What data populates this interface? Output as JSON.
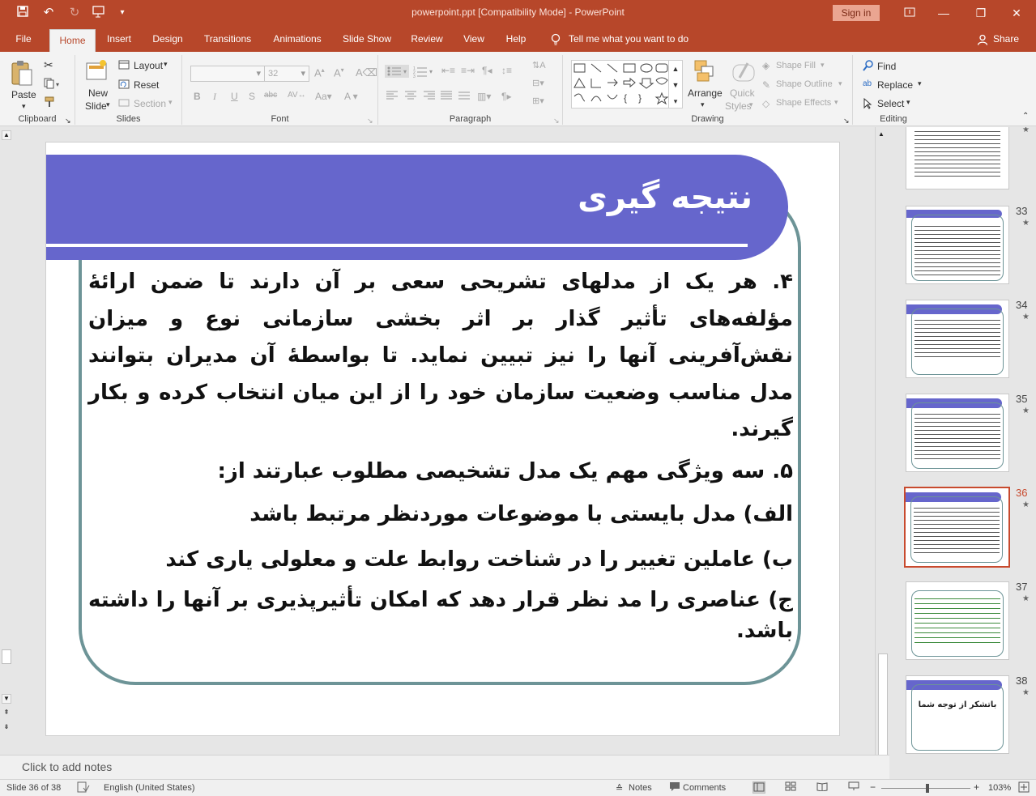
{
  "app": {
    "title": "powerpoint.ppt [Compatibility Mode]  -  PowerPoint",
    "sign_in": "Sign in",
    "share": "Share",
    "tell_me": "Tell me what you want to do"
  },
  "tabs": [
    "File",
    "Home",
    "Insert",
    "Design",
    "Transitions",
    "Animations",
    "Slide Show",
    "Review",
    "View",
    "Help"
  ],
  "ribbon": {
    "clipboard": {
      "label": "Clipboard",
      "paste": "Paste"
    },
    "slides": {
      "label": "Slides",
      "new_slide_1": "New",
      "new_slide_2": "Slide",
      "layout": "Layout",
      "reset": "Reset",
      "section": "Section"
    },
    "font": {
      "label": "Font",
      "size": "32"
    },
    "paragraph": {
      "label": "Paragraph"
    },
    "drawing": {
      "label": "Drawing",
      "arrange": "Arrange",
      "quick_styles_1": "Quick",
      "quick_styles_2": "Styles",
      "shape_fill": "Shape Fill",
      "shape_outline": "Shape Outline",
      "shape_effects": "Shape Effects"
    },
    "editing": {
      "label": "Editing",
      "find": "Find",
      "replace": "Replace",
      "select": "Select"
    }
  },
  "slide": {
    "title": "نتیجه گیری",
    "p4_num": "۴.",
    "p4": "هر یک از مدلهای تشریحی سعی بر آن دارند تا ضمن ارائۀ مؤلفه‌های تأثیر گذار بر اثر بخشی  سازمانی نوع و میزان نقش‌آفرینی آنها را نیز تبیین نماید. تا بواسطۀ آن مدیران بتوانند مدل مناسب  وضعیت سازمان خود را از این میان انتخاب کرده و بکار گیرند.",
    "p5": "۵. سه ویژگی مهم یک مدل تشخیصی مطلوب عبارتند از:",
    "a": "الف) مدل بایستی با موضوعات موردنظر مرتبط باشد",
    "b": "ب) عاملین تغییر را در شناخت روابط علت و معلولی یاری کند",
    "c": "ج) عناصری را مد نظر قرار دهد که امکان تأثیرپذیری بر آنها را داشته باشد."
  },
  "thumbnails": [
    {
      "num": "33"
    },
    {
      "num": "34"
    },
    {
      "num": "35"
    },
    {
      "num": "36"
    },
    {
      "num": "37"
    },
    {
      "num": "38",
      "text": "باتشکر از توجه شما"
    }
  ],
  "notes_placeholder": "Click to add notes",
  "status": {
    "slide": "Slide 36 of 38",
    "language": "English (United States)",
    "notes": "Notes",
    "comments": "Comments",
    "zoom": "103%"
  }
}
